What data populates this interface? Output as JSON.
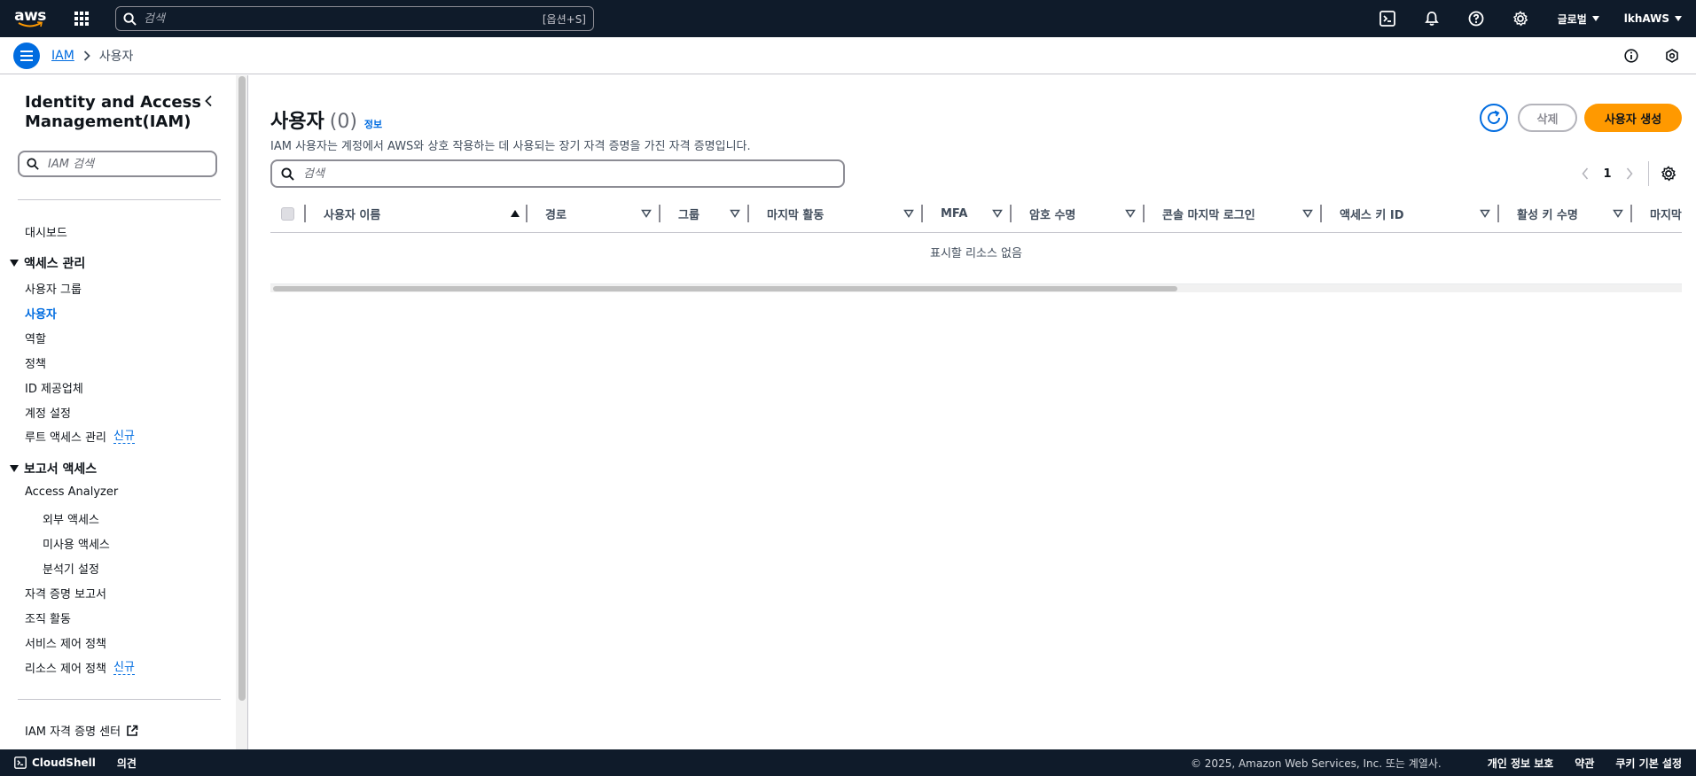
{
  "topnav": {
    "logo_text": "aws",
    "search_placeholder": "검색",
    "search_shortcut": "[옵션+S]",
    "region_label": "글로벌",
    "account_label": "lkhAWS"
  },
  "breadcrumb": {
    "service": "IAM",
    "current": "사용자"
  },
  "sidebar": {
    "title": "Identity and Access Management(IAM)",
    "search_placeholder": "IAM 검색",
    "dashboard": "대시보드",
    "section_access": "액세스 관리",
    "access_items": [
      "사용자 그룹",
      "사용자",
      "역할",
      "정책",
      "ID 제공업체",
      "계정 설정",
      "루트 액세스 관리"
    ],
    "new_badge": "신규",
    "section_reports": "보고서 액세스",
    "access_analyzer": "Access Analyzer",
    "analyzer_items": [
      "외부 액세스",
      "미사용 액세스",
      "분석기 설정"
    ],
    "report_items": [
      "자격 증명 보고서",
      "조직 활동",
      "서비스 제어 정책",
      "리소스 제어 정책"
    ],
    "identity_center": "IAM 자격 증명 센터",
    "active_item": "사용자"
  },
  "main": {
    "title": "사용자",
    "count": "(0)",
    "info_link": "정보",
    "description": "IAM 사용자는 계정에서 AWS와 상호 작용하는 데 사용되는 장기 자격 증명을 가진 자격 증명입니다.",
    "delete_button": "삭제",
    "create_button": "사용자 생성",
    "search_placeholder": "검색",
    "page_number": "1",
    "columns": [
      "사용자 이름",
      "경로",
      "그룹",
      "마지막 활동",
      "MFA",
      "암호 수명",
      "콘솔 마지막 로그인",
      "액세스 키 ID",
      "활성 키 수명",
      "마지막"
    ],
    "empty_message": "표시할 리소스 없음"
  },
  "footer": {
    "cloudshell": "CloudShell",
    "feedback": "의견",
    "copyright": "© 2025, Amazon Web Services, Inc. 또는 계열사.",
    "privacy": "개인 정보 보호",
    "terms": "약관",
    "cookies": "쿠키 기본 설정"
  },
  "colors": {
    "nav_bg": "#0f1b2a",
    "link_blue": "#006ce0",
    "primary_orange": "#ff9900",
    "border_grey": "#8c8c94"
  }
}
